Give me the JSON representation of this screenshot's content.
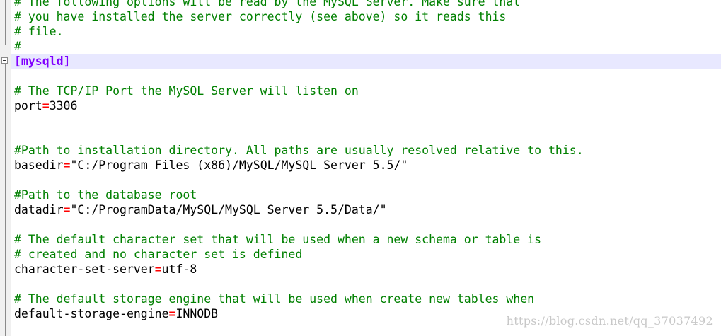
{
  "editor": {
    "lines": {
      "l0": "# The following options will be read by the MySQL Server. Make sure that",
      "l1": "# you have installed the server correctly (see above) so it reads this",
      "l2": "# file.",
      "l3": "#",
      "l4": "[mysqld]",
      "l5": "",
      "l6": "# The TCP/IP Port the MySQL Server will listen on",
      "l7_key": "port",
      "l7_eq": "=",
      "l7_val": "3306",
      "l10": "#Path to installation directory. All paths are usually resolved relative to this.",
      "l11_key": "basedir",
      "l11_eq": "=",
      "l11_val": "\"C:/Program Files (x86)/MySQL/MySQL Server 5.5/\"",
      "l13": "#Path to the database root",
      "l14_key": "datadir",
      "l14_eq": "=",
      "l14_val": "\"C:/ProgramData/MySQL/MySQL Server 5.5/Data/\"",
      "l16": "# The default character set that will be used when a new schema or table is",
      "l17": "# created and no character set is defined",
      "l18_key": "character-set-server",
      "l18_eq": "=",
      "l18_val": "utf-8",
      "l20": "# The default storage engine that will be used when create new tables when",
      "l21_key": "default-storage-engine",
      "l21_eq": "=",
      "l21_val": "INNODB"
    },
    "colors": {
      "comment": "#008000",
      "section": "#8000ff",
      "operator": "#ff0000",
      "current_line": "#e8e8ff"
    }
  },
  "watermark": "https://blog.csdn.net/qq_37037492"
}
